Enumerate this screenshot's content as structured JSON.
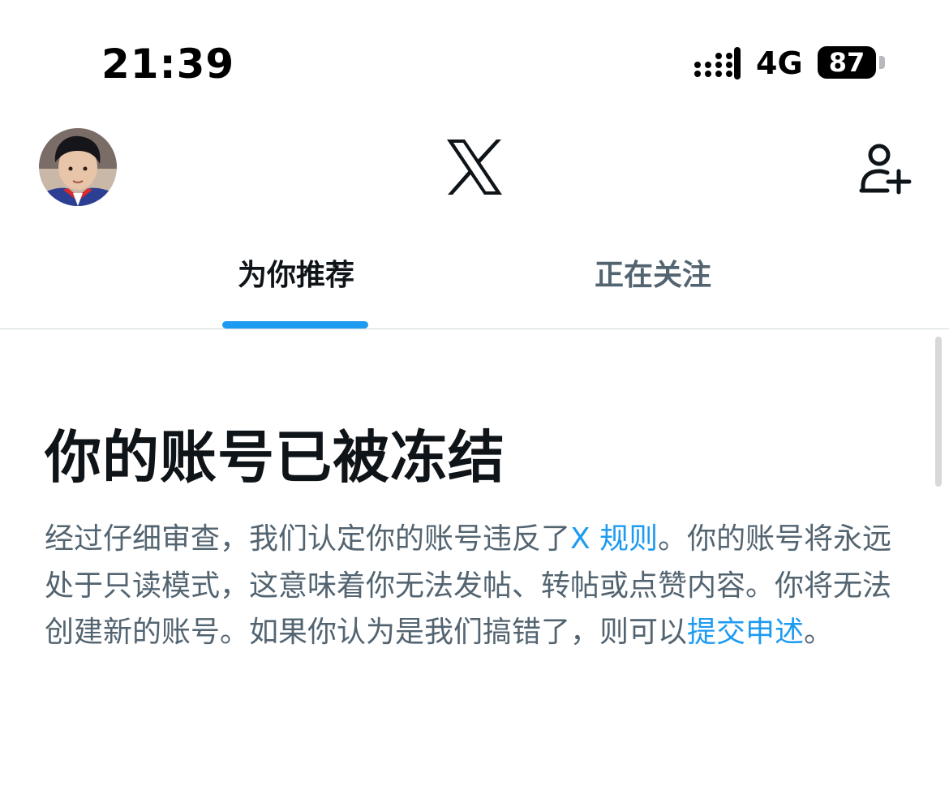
{
  "status_bar": {
    "time": "21:39",
    "network": "4G",
    "battery": "87"
  },
  "header": {
    "avatar_icon": "user-avatar",
    "logo_icon": "x-logo-icon",
    "follow_icon": "add-user-icon"
  },
  "tabs": [
    {
      "label": "为你推荐",
      "active": true
    },
    {
      "label": "正在关注",
      "active": false
    }
  ],
  "notice": {
    "title": "你的账号已被冻结",
    "body_part1": "经过仔细审查，我们认定你的账号违反了",
    "rules_link": "X 规则",
    "body_part2": "。你的账号将永远处于只读模式，这意味着你无法发帖、转帖或点赞内容。你将无法创建新的账号。如果你认为是我们搞错了，则可以",
    "appeal_link": "提交申述",
    "body_end": "。"
  },
  "colors": {
    "accent": "#1d9bf0",
    "text_primary": "#0f1419",
    "text_secondary": "#536471",
    "divider": "#cfd9de"
  }
}
